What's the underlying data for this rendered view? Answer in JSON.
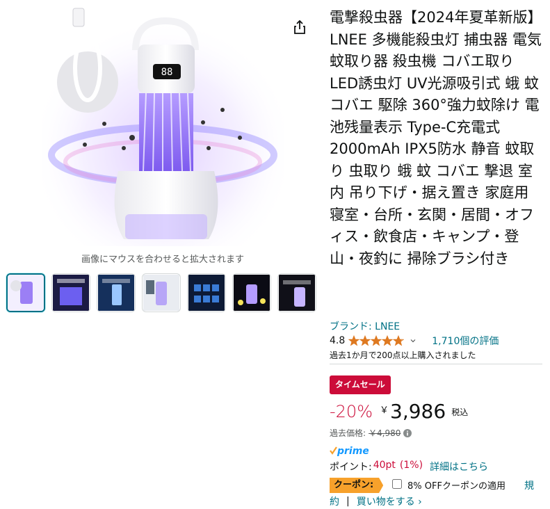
{
  "product": {
    "title": "電撃殺虫器【2024年夏革新版】LNEE 多機能殺虫灯 捕虫器 電気蚊取り器 殺虫機 コバエ取り LED誘虫灯 UV光源吸引式 蛾 蚊 コバエ 駆除 360°強力蚊除け 電池残量表示 Type-C充電式 2000mAh IPX5防水 静音 蚊取り 虫取り 蛾 蚊 コバエ 撃退 室内 吊り下げ・据え置き 家庭用 寝室・台所・玄関・居間・オフィス・飲食店・キャンプ・登山・夜釣に 掃除ブラシ付き",
    "brand_link": "ブランド: LNEE",
    "rating": "4.8",
    "rating_stars": 4.8,
    "reviews_link": "1,710個の評価",
    "bought_text": "過去1か月で200点以上購入されました",
    "display_readout": "88"
  },
  "gallery": {
    "hover_hint": "画像にマウスを合わせると拡大されます",
    "thumb_count": 7,
    "selected_index": 0
  },
  "deal": {
    "badge": "タイムセール",
    "discount": "-20%",
    "currency": "￥",
    "price": "3,986",
    "tax": "税込",
    "list_label": "過去価格:",
    "list_price": "￥4,980"
  },
  "prime": {
    "label": "prime"
  },
  "points": {
    "label": "ポイント:",
    "value": "40pt",
    "percent": "(1%)",
    "details_link": "詳細はこちら"
  },
  "coupon": {
    "badge": "クーポン:",
    "text": "8% OFFクーポンの適用",
    "terms_part1": "規",
    "terms_part2": "約",
    "separator": "|",
    "shop_link": "買い物をする ›"
  },
  "colors": {
    "link": "#007185",
    "deal_red": "#cc0c39",
    "star": "#de7921",
    "coupon_orange": "#f7a12b",
    "prime_blue": "#1399ff"
  }
}
